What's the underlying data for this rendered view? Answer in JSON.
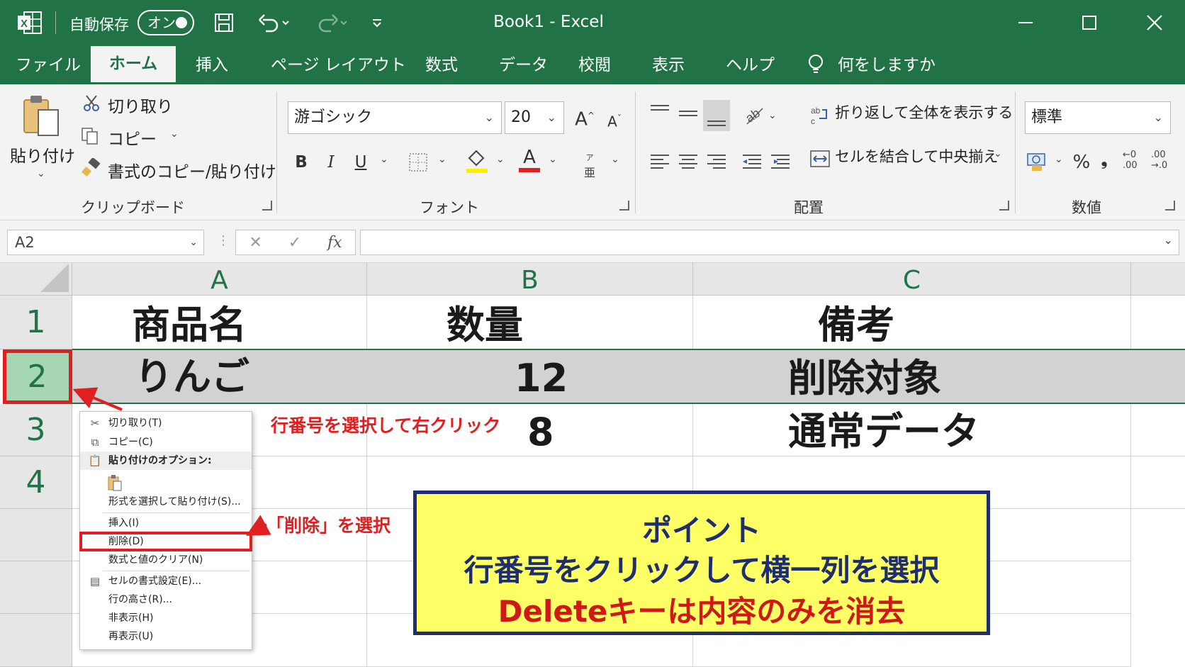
{
  "titlebar": {
    "autosave_label": "自動保存",
    "autosave_state": "オン",
    "document_title": "Book1  -  Excel",
    "brand_color": "#217346"
  },
  "tabs": [
    {
      "label": "ファイル"
    },
    {
      "label": "ホーム",
      "active": true
    },
    {
      "label": "挿入"
    },
    {
      "label": "ページ レイアウト"
    },
    {
      "label": "数式"
    },
    {
      "label": "データ"
    },
    {
      "label": "校閲"
    },
    {
      "label": "表示"
    },
    {
      "label": "ヘルプ"
    },
    {
      "label": "何をしますか"
    }
  ],
  "ribbon": {
    "clipboard": {
      "paste": "貼り付け",
      "cut": "切り取り",
      "copy": "コピー",
      "format_painter": "書式のコピー/貼り付け",
      "group": "クリップボード"
    },
    "font": {
      "font_name": "游ゴシック",
      "font_size": "20",
      "grow": "A",
      "shrink": "A",
      "bold": "B",
      "italic": "I",
      "underline": "U",
      "font_color_letter": "A",
      "phonetic": "亜",
      "group": "フォント"
    },
    "alignment": {
      "wrap_text": "折り返して全体を表示する",
      "merge_center": "セルを結合して中央揃え",
      "group": "配置"
    },
    "number": {
      "format": "標準",
      "percent": "%",
      "comma": "❟",
      "inc_decimal": "←0 .00",
      "dec_decimal": ".00 →.0",
      "group": "数値"
    }
  },
  "formula_bar": {
    "name_box": "A2",
    "fx": "fx",
    "cancel": "✕",
    "enter": "✓",
    "content": ""
  },
  "grid": {
    "columns": [
      "A",
      "B",
      "C"
    ],
    "rows": [
      {
        "num": "1",
        "cells": [
          "商品名",
          "数量",
          "備考"
        ]
      },
      {
        "num": "2",
        "cells": [
          "りんご",
          "12",
          "削除対象"
        ],
        "selected": true
      },
      {
        "num": "3",
        "cells": [
          "",
          "8",
          "通常データ"
        ]
      },
      {
        "num": "4",
        "cells": [
          "",
          "",
          ""
        ]
      }
    ]
  },
  "context_menu": {
    "cut": "切り取り(T)",
    "copy": "コピー(C)",
    "paste_options": "貼り付けのオプション:",
    "paste_special": "形式を選択して貼り付け(S)...",
    "insert": "挿入(I)",
    "delete": "削除(D)",
    "clear": "数式と値のクリア(N)",
    "format_cells": "セルの書式設定(E)...",
    "row_height": "行の高さ(R)...",
    "hide": "非表示(H)",
    "unhide": "再表示(U)"
  },
  "annotations": {
    "callout_rightclick": "行番号を選択して右クリック",
    "callout_delete": "「削除」を選択",
    "point_title": "ポイント",
    "point_line1": "行番号をクリックして横一列を選択",
    "point_line2": "Deleteキーは内容のみを消去",
    "highlight_color": "#e02020",
    "box_fill": "#ffff66",
    "box_border": "#1e2e6e"
  }
}
